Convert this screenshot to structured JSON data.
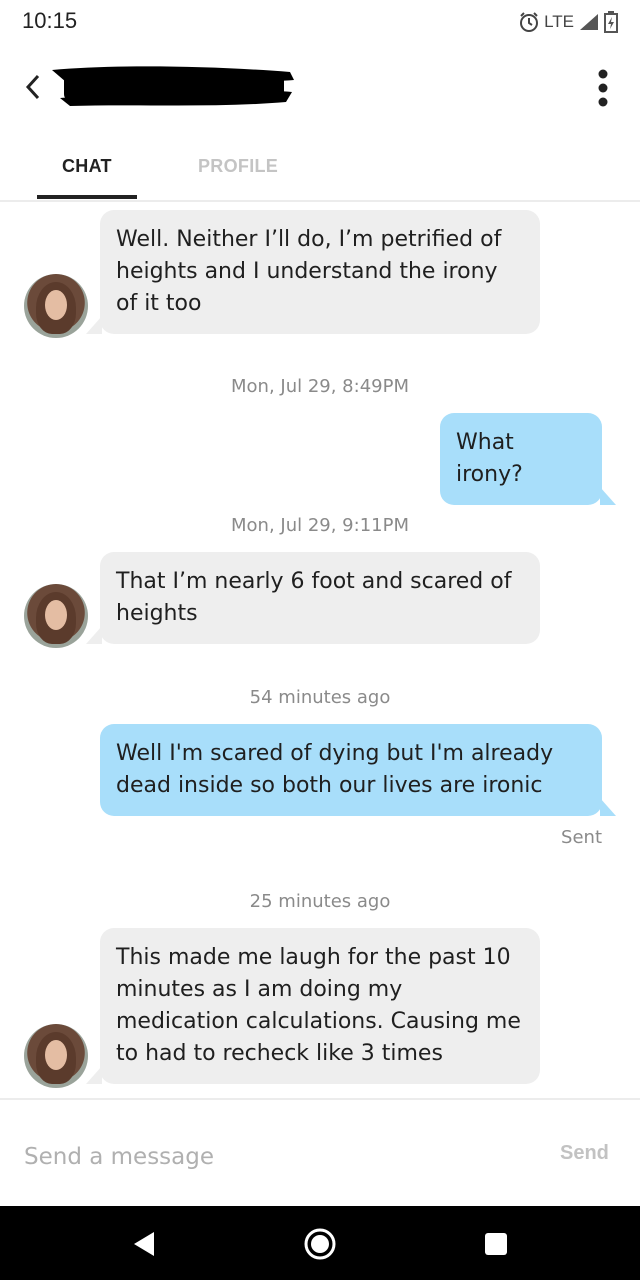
{
  "status_bar": {
    "time": "10:15",
    "network": "LTE",
    "icons": [
      "alarm-icon",
      "signal-icon",
      "battery-icon"
    ]
  },
  "header": {
    "back_icon": "chevron-left-icon",
    "menu_icon": "more-vertical-icon"
  },
  "tabs": [
    {
      "label": "CHAT",
      "active": true
    },
    {
      "label": "PROFILE",
      "active": false
    }
  ],
  "messages": [
    {
      "direction": "in",
      "text": "Well. Neither I’ll do, I’m petrified of heights and I understand the irony of it too"
    },
    {
      "timestamp": "Mon, Jul 29, 8:49PM"
    },
    {
      "direction": "out",
      "text": "What irony?"
    },
    {
      "timestamp": "Mon, Jul 29, 9:11PM"
    },
    {
      "direction": "in",
      "text": "That I’m nearly 6 foot and scared of heights"
    },
    {
      "timestamp": "54 minutes ago"
    },
    {
      "direction": "out",
      "text": "Well I'm scared of dying but I'm already dead inside so both our lives are ironic",
      "status": "Sent"
    },
    {
      "timestamp": "25 minutes ago"
    },
    {
      "direction": "in",
      "text": "This made me laugh for the past 10 minutes as I am doing my medication calculations. Causing me to had to recheck like 3 times"
    }
  ],
  "composer": {
    "placeholder": "Send a message",
    "send_label": "Send"
  },
  "nav": {
    "icons": [
      "back-triangle-icon",
      "home-circle-icon",
      "recents-square-icon"
    ]
  },
  "colors": {
    "incoming_bubble": "#eeeeee",
    "outgoing_bubble": "#a8defa",
    "active_tab": "#222222",
    "inactive_tab": "#c4c4c4"
  }
}
